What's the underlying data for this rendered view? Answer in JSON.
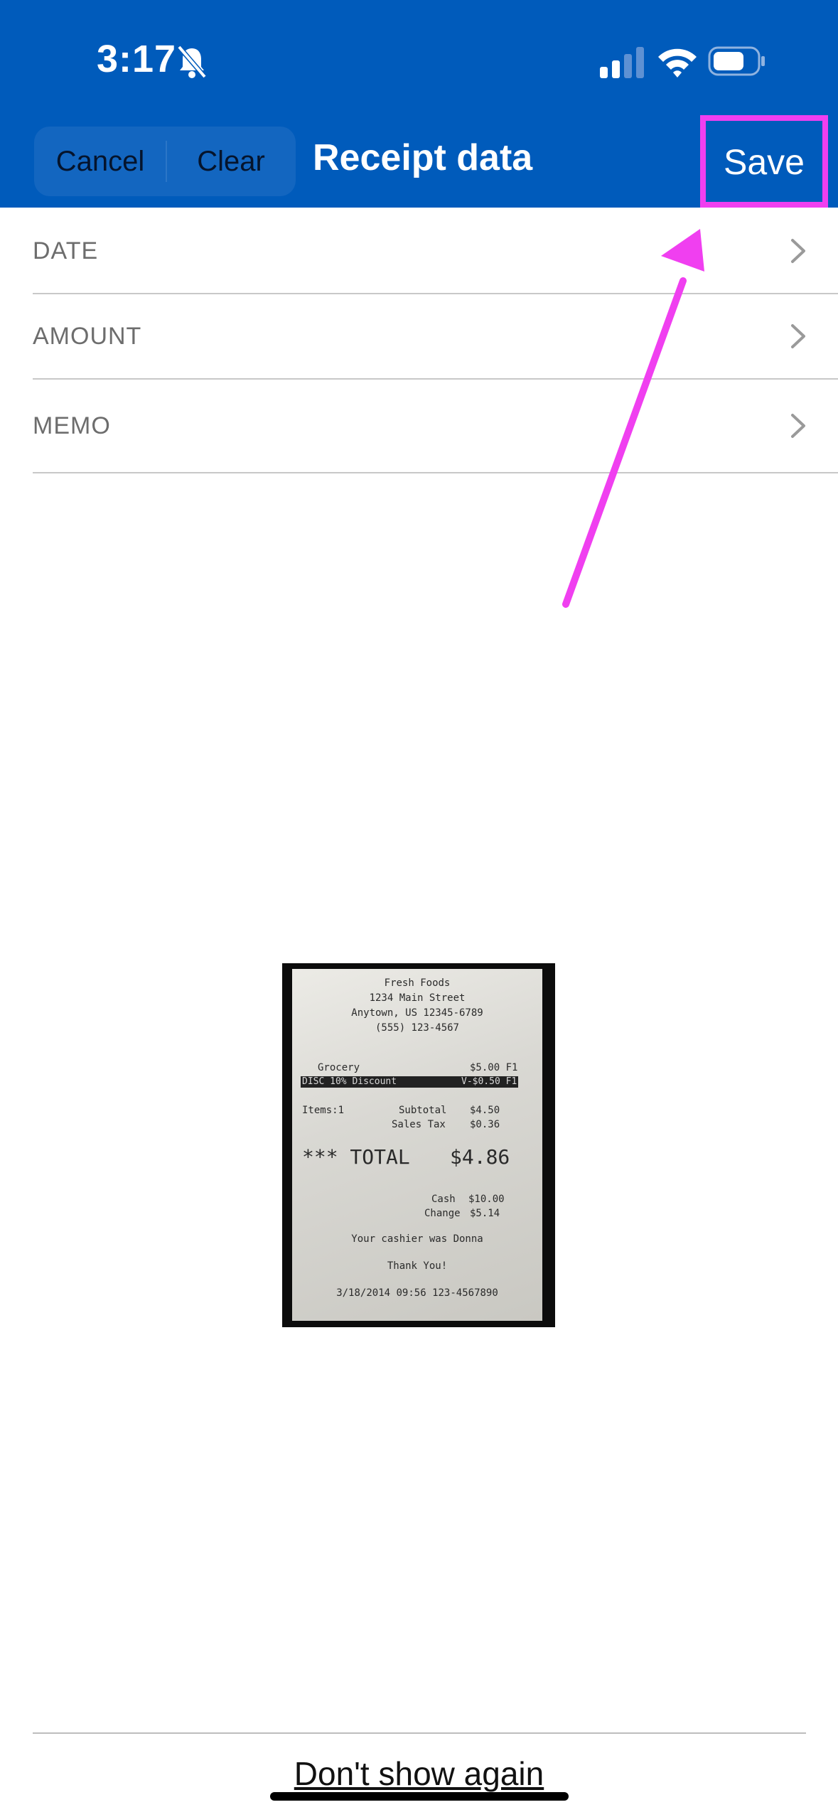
{
  "status_bar": {
    "time": "3:17"
  },
  "nav": {
    "cancel_label": "Cancel",
    "clear_label": "Clear",
    "title": "Receipt data",
    "save_label": "Save"
  },
  "fields": [
    {
      "label": "DATE"
    },
    {
      "label": "AMOUNT"
    },
    {
      "label": "MEMO"
    }
  ],
  "receipt": {
    "store": "Fresh Foods",
    "street": "1234 Main Street",
    "city": "Anytown, US 12345-6789",
    "phone": "(555) 123-4567",
    "item_name": "Grocery",
    "item_price": "$5.00 F1",
    "discount_name": "DISC 10% Discount",
    "discount_value": "V-$0.50 F1",
    "items_count": "Items:1",
    "subtotal_label": "Subtotal",
    "subtotal_value": "$4.50",
    "tax_label": "Sales Tax",
    "tax_value": "$0.36",
    "total_label": "*** TOTAL",
    "total_value": "$4.86",
    "cash_label": "Cash",
    "cash_value": "$10.00",
    "change_label": "Change",
    "change_value": "$5.14",
    "cashier": "Your cashier was Donna",
    "thanks": "Thank You!",
    "footer": "3/18/2014 09:56 123-4567890"
  },
  "bottom": {
    "dont_show_label": "Don't show again"
  },
  "colors": {
    "header_bg": "#005bbb",
    "highlight": "#f03ff0"
  }
}
